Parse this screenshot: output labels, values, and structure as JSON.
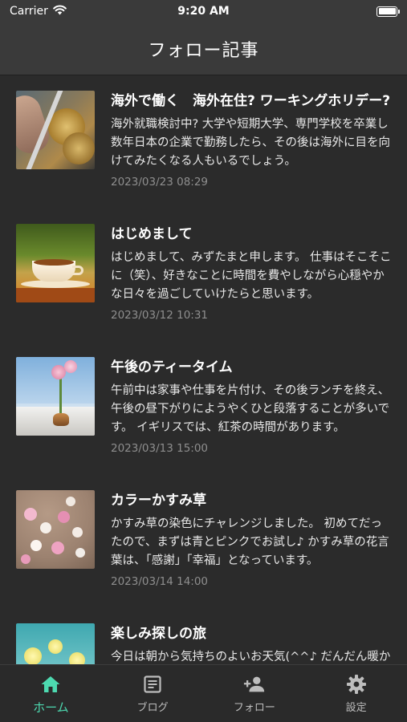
{
  "status_bar": {
    "carrier": "Carrier",
    "time": "9:20 AM",
    "battery_level": 1.0
  },
  "nav": {
    "title": "フォロー記事"
  },
  "articles": [
    {
      "title": "海外で働く　海外在住? ワーキングホリデー?",
      "excerpt": "海外就職検討中? 大学や短期大学、専門学校を卒業し数年日本の企業で勤務したら、その後は海外に目を向けてみたくなる人もいるでしょう。",
      "date": "2023/03/23 08:29",
      "thumb": "coins-zipper"
    },
    {
      "title": "はじめまして",
      "excerpt": "はじめまして、みずたまと申します。 仕事はそこそこに（笑）、好きなことに時間を費やしながら心穏やかな日々を過ごしていけたらと思います。",
      "date": "2023/03/12 10:31",
      "thumb": "teacup"
    },
    {
      "title": "午後のティータイム",
      "excerpt": "午前中は家事や仕事を片付け、その後ランチを終え、午後の昼下がりにようやくひと段落することが多いです。 イギリスでは、紅茶の時間があります。",
      "date": "2023/03/13 15:00",
      "thumb": "window-flower"
    },
    {
      "title": "カラーかすみ草",
      "excerpt": "かすみ草の染色にチャレンジしました。 初めてだったので、まずは青とピンクでお試し♪ かすみ草の花言葉は、「感謝」「幸福」となっています。",
      "date": "2023/03/14 14:00",
      "thumb": "gypsophila"
    },
    {
      "title": "楽しみ探しの旅",
      "excerpt": "今日は朝から気持ちのよいお天気(^^♪ だんだん暖かくなってきました。",
      "date": "",
      "thumb": "yellow-flowers"
    }
  ],
  "tabs": [
    {
      "label": "ホーム",
      "icon": "home-icon",
      "active": true
    },
    {
      "label": "ブログ",
      "icon": "article-icon",
      "active": false
    },
    {
      "label": "フォロー",
      "icon": "person-add-icon",
      "active": false
    },
    {
      "label": "設定",
      "icon": "gear-icon",
      "active": false
    }
  ],
  "colors": {
    "accent": "#4dd9b0",
    "background": "#2b2b2b",
    "bar": "#3a3a3a",
    "date_text": "#8e8e8e"
  }
}
